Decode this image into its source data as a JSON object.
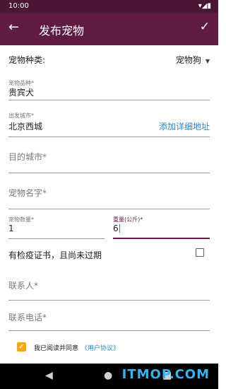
{
  "status_bar": {
    "time": "10:00",
    "icons_text": "▾◢▮"
  },
  "app_bar": {
    "title": "发布宠物",
    "back_icon": "←",
    "confirm_icon": "✓"
  },
  "pet_type": {
    "label": "宠物种类:",
    "value": "宠物狗",
    "arrow": "▼"
  },
  "breed": {
    "label": "宠物品种*",
    "value": "贵宾犬"
  },
  "origin": {
    "label": "出发城市*",
    "value": "北京西城",
    "link": "添加详细地址"
  },
  "destination": {
    "placeholder": "目的城市*"
  },
  "pet_name": {
    "placeholder": "宠物名字*"
  },
  "count": {
    "label": "宠物数量*",
    "value": "1"
  },
  "weight": {
    "label": "重量(公斤)*",
    "value": "6"
  },
  "quarantine": {
    "label": "有检疫证书，且尚未过期",
    "checked": false
  },
  "contact": {
    "placeholder": "联系人*"
  },
  "phone": {
    "placeholder": "联系电话*"
  },
  "agreement": {
    "checked": true,
    "check_glyph": "✓",
    "text": "我已阅读并同意",
    "link": "《用户协议》"
  },
  "nav_bar": {
    "back": "◀",
    "home": "●",
    "recent": "■"
  },
  "watermark": "ITMOP.COM"
}
